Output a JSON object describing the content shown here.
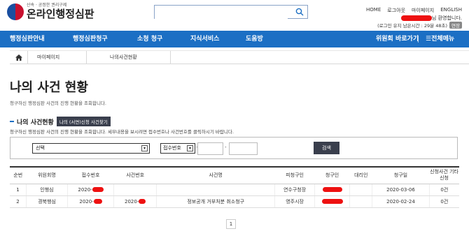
{
  "header": {
    "logo_sub": "산속 · 공정한 권리구제",
    "logo_main": "온라인행정심판",
    "search_placeholder": "",
    "util": [
      "HOME",
      "로그아웃",
      "마이페이지",
      "ENGLISH"
    ],
    "welcome_suffix": "님 환영합니다.",
    "session_text": "(로그인 유지 남은시간 : 29분 48초)",
    "extend_label": "연장"
  },
  "nav": {
    "items": [
      "행정심판안내",
      "행정심판청구",
      "소청 청구",
      "지식서비스",
      "도움방"
    ],
    "committee_link": "위원회 바로가기",
    "all_menu": "☰전체메뉴"
  },
  "breadcrumb": {
    "items": [
      "마이페이지",
      "나의사건현황"
    ]
  },
  "page": {
    "title": "나의 사건 현황",
    "desc": "청구하신 행정심판 사건의 진행 현황을 조회합니다."
  },
  "section": {
    "title": "나의 사건현황",
    "find_button": "나의 (서면)신청 사건찾기",
    "desc": "청구하신 행정심판 사건의 진행 현황을 조회합니다. 세부내용을 보시려면 접수번호나 사건번호를 클릭하시기 바랍니다."
  },
  "search": {
    "select_value": "선택",
    "type_value": "접수번호",
    "dash": "-",
    "button": "검색"
  },
  "table": {
    "headers": [
      "순번",
      "위원회명",
      "접수번호",
      "사건번호",
      "사건명",
      "피청구인",
      "청구인",
      "대리인",
      "청구일",
      "신청사건 기타신청"
    ],
    "rows": [
      {
        "no": "1",
        "committee": "인행심",
        "receipt": "2020-",
        "case_no": "",
        "case_name": "",
        "respondent": "연수구청장",
        "claimant": "",
        "agent": "",
        "date": "2020-03-06",
        "other": "0건"
      },
      {
        "no": "2",
        "committee": "경북행심",
        "receipt": "2020-",
        "case_no": "2020-",
        "case_name": "정보공개 거부처분 취소청구",
        "respondent": "영주시장",
        "claimant": "",
        "agent": "",
        "date": "2020-02-24",
        "other": "0건"
      }
    ]
  },
  "pagination": {
    "current": "1"
  }
}
